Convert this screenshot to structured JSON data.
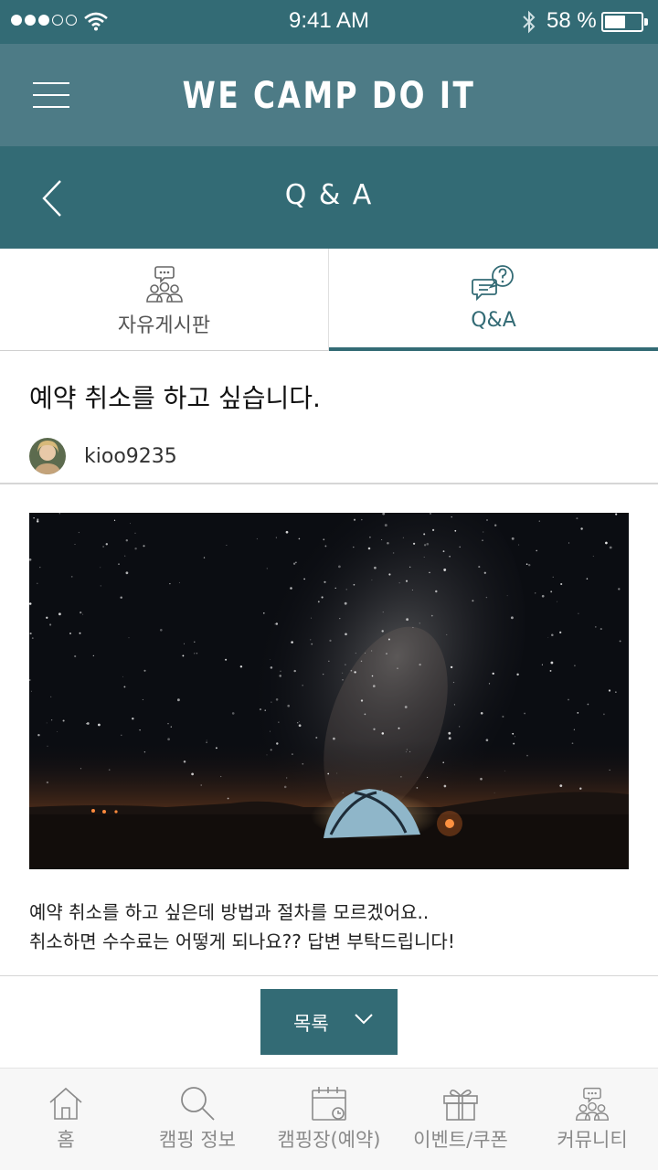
{
  "status_bar": {
    "time": "9:41 AM",
    "battery_text": "58 %",
    "battery_level": 0.58,
    "signal_bars": 5,
    "signal_filled": 3
  },
  "header": {
    "title": "WE CAMP DO IT",
    "menu_icon": "hamburger-icon"
  },
  "sub_header": {
    "title": "Q & A",
    "back_icon": "chevron-left-icon"
  },
  "tabs": [
    {
      "label": "자유게시판",
      "icon": "community-icon",
      "active": false
    },
    {
      "label": "Q&A",
      "icon": "question-chat-icon",
      "active": true
    }
  ],
  "post": {
    "title": "예약 취소를 하고 싶습니다.",
    "author": "kioo9235",
    "body_line_1": "예약 취소를 하고 싶은데 방법과 절차를 모르겠어요..",
    "body_line_2": "취소하면 수수료는 어떻게 되나요??  답변 부탁드립니다!"
  },
  "list_button": {
    "label": "목록",
    "icon": "chevron-down-icon"
  },
  "bottom_nav": [
    {
      "label": "홈",
      "icon": "home-icon"
    },
    {
      "label": "캠핑 정보",
      "icon": "search-icon"
    },
    {
      "label": "캠핑장(예약)",
      "icon": "calendar-icon"
    },
    {
      "label": "이벤트/쿠폰",
      "icon": "gift-icon"
    },
    {
      "label": "커뮤니티",
      "icon": "community-icon"
    }
  ],
  "colors": {
    "primary": "#336b75",
    "header": "#4d7b86",
    "nav_background": "#f7f7f7",
    "nav_text": "#8a8a8a"
  }
}
